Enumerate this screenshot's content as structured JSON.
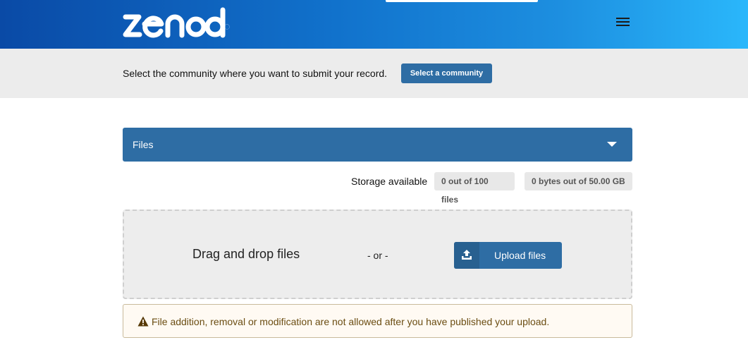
{
  "header": {
    "logo_text": "zenodo",
    "menu_icon": "hamburger-icon",
    "colors": {
      "gradient_start": "#0a4aa6",
      "gradient_end": "#2ab7fb"
    }
  },
  "community": {
    "prompt": "Select the community where you want to submit your record.",
    "button_label": "Select a community"
  },
  "files_section": {
    "title": "Files",
    "toggle_icon": "caret-down-icon"
  },
  "storage": {
    "label": "Storage available",
    "files_badge": "0 out of 100 files",
    "bytes_badge": "0 bytes out of 50.00 GB"
  },
  "dropzone": {
    "text": "Drag and drop files",
    "separator": "- or -",
    "upload_button": "Upload files",
    "upload_icon": "upload-icon"
  },
  "warning": {
    "icon": "warning-icon",
    "text": "File addition, removal or modification are not allowed after you have published your upload."
  },
  "colors": {
    "primary": "#2e6da4",
    "bar_background": "#ececec",
    "warning_text": "#6b4d12"
  }
}
